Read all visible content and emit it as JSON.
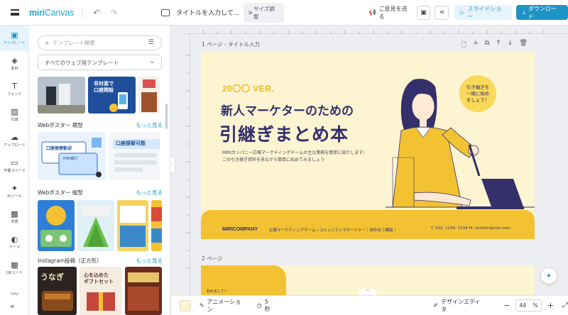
{
  "app": {
    "logo": "miri",
    "logo_suffix": "Canvas"
  },
  "header": {
    "doc_title": "タイトルを入力して...",
    "resize_label": "サイズ調整",
    "feedback_label": "ご意見を送る",
    "slideshow_label": "スライドショー",
    "download_label": "ダウンロード"
  },
  "rail": {
    "items": [
      {
        "label": "テンプレート",
        "icon": "template-icon",
        "glyph": "▣"
      },
      {
        "label": "素材",
        "icon": "elements-icon",
        "glyph": "◈"
      },
      {
        "label": "フォント",
        "icon": "font-icon",
        "glyph": "T"
      },
      {
        "label": "写真",
        "icon": "photo-icon",
        "glyph": "▨"
      },
      {
        "label": "アップロード",
        "icon": "upload-icon",
        "glyph": "☁"
      },
      {
        "label": "作業スペース",
        "icon": "workspace-icon",
        "glyph": "▭"
      },
      {
        "label": "AIツール",
        "icon": "ai-icon",
        "glyph": "✦"
      },
      {
        "label": "背景",
        "icon": "background-icon",
        "glyph": "▩"
      },
      {
        "label": "テーマ",
        "icon": "theme-icon",
        "glyph": "◐"
      },
      {
        "label": "QRコード",
        "icon": "qr-icon",
        "glyph": "▦"
      }
    ]
  },
  "panel": {
    "search_placeholder": "テンプレート検索",
    "scope_select": "すべてのウェブ用テンプレート",
    "sections": [
      {
        "title": "Webポスター 横型",
        "more": "もっと見る"
      },
      {
        "title": "Webポスター 縦型",
        "more": "もっと見る"
      },
      {
        "title": "Instagram投稿（正方形）",
        "more": "もっと見る"
      }
    ],
    "thumb_texts": {
      "t1": "非対面で\n口座開設",
      "t2": "口座振替歓迎",
      "t3": "口座振替可能",
      "t4": "MIRI銀行",
      "t5": "心を込めた\nギフトセット",
      "t6": "うなぎ"
    }
  },
  "canvas": {
    "page1_label": "1 ページ",
    "page1_title": "- タイトル入力",
    "page2_label": "2 ページ",
    "slide": {
      "ver": "20〇〇 VER.",
      "headline1": "新人マーケターのための",
      "headline2": "引継ぎまとめ本",
      "desc1": "MIRIカンパニー広報マーケティングチームの主な業務を簡単に紹介します!",
      "desc2": "この引き継ぎ資料を見ながら簡単に始めてみましょう",
      "bubble_lines": [
        "引き継ぎを",
        "一緒に始め",
        "ましょう！"
      ],
      "brand": "MIRICOMPANY",
      "footer_info": "広報マーケティングチーム / コミュニティマネージャー｜田中みう課長｜",
      "footer_contact": "T. 010. 1234. 1234  M. mirikim@miri.com"
    },
    "page2_text": "初めまして！"
  },
  "bottom": {
    "animation_label": "アニメーション",
    "duration_label": "5秒",
    "design_editor_label": "デザインエディタ",
    "zoom": "44",
    "zoom_unit": "%"
  },
  "colors": {
    "accent": "#1d93c6",
    "slide_bg": "#fdf4d2",
    "slide_yellow": "#f3c233",
    "slide_navy": "#33306b"
  }
}
